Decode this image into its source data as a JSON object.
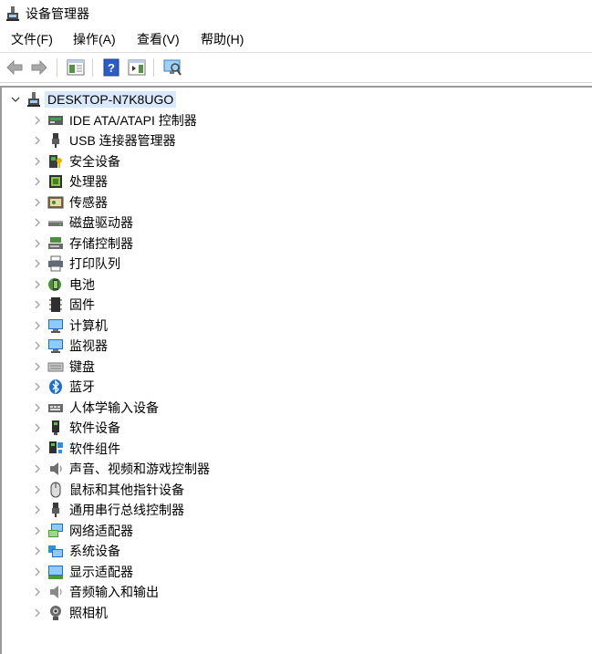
{
  "window": {
    "title": "设备管理器"
  },
  "menu": [
    "文件(F)",
    "操作(A)",
    "查看(V)",
    "帮助(H)"
  ],
  "toolbar": [
    "back-icon",
    "forward-icon",
    "show-hide-console-tree-icon",
    "help-icon",
    "properties-pane-icon",
    "scan-hardware-icon"
  ],
  "tree": {
    "root": "DESKTOP-N7K8UGO",
    "categories": [
      {
        "label": "IDE ATA/ATAPI 控制器",
        "icon": "ide-controller-icon"
      },
      {
        "label": "USB 连接器管理器",
        "icon": "usb-connector-icon"
      },
      {
        "label": "安全设备",
        "icon": "security-device-icon"
      },
      {
        "label": "处理器",
        "icon": "processor-icon"
      },
      {
        "label": "传感器",
        "icon": "sensor-icon"
      },
      {
        "label": "磁盘驱动器",
        "icon": "disk-drive-icon"
      },
      {
        "label": "存储控制器",
        "icon": "storage-controller-icon"
      },
      {
        "label": "打印队列",
        "icon": "print-queue-icon"
      },
      {
        "label": "电池",
        "icon": "battery-icon"
      },
      {
        "label": "固件",
        "icon": "firmware-icon"
      },
      {
        "label": "计算机",
        "icon": "computer-icon"
      },
      {
        "label": "监视器",
        "icon": "monitor-icon"
      },
      {
        "label": "键盘",
        "icon": "keyboard-icon"
      },
      {
        "label": "蓝牙",
        "icon": "bluetooth-icon"
      },
      {
        "label": "人体学输入设备",
        "icon": "hid-icon"
      },
      {
        "label": "软件设备",
        "icon": "software-device-icon"
      },
      {
        "label": "软件组件",
        "icon": "software-component-icon"
      },
      {
        "label": "声音、视频和游戏控制器",
        "icon": "sound-icon"
      },
      {
        "label": "鼠标和其他指针设备",
        "icon": "mouse-icon"
      },
      {
        "label": "通用串行总线控制器",
        "icon": "usb-controller-icon"
      },
      {
        "label": "网络适配器",
        "icon": "network-adapter-icon"
      },
      {
        "label": "系统设备",
        "icon": "system-device-icon"
      },
      {
        "label": "显示适配器",
        "icon": "display-adapter-icon"
      },
      {
        "label": "音频输入和输出",
        "icon": "audio-io-icon"
      },
      {
        "label": "照相机",
        "icon": "camera-icon"
      }
    ]
  },
  "colors": {
    "selection": "#d9e8fb",
    "icon_blue": "#1f6fc9",
    "arrow_gray": "#a0a0a0"
  }
}
